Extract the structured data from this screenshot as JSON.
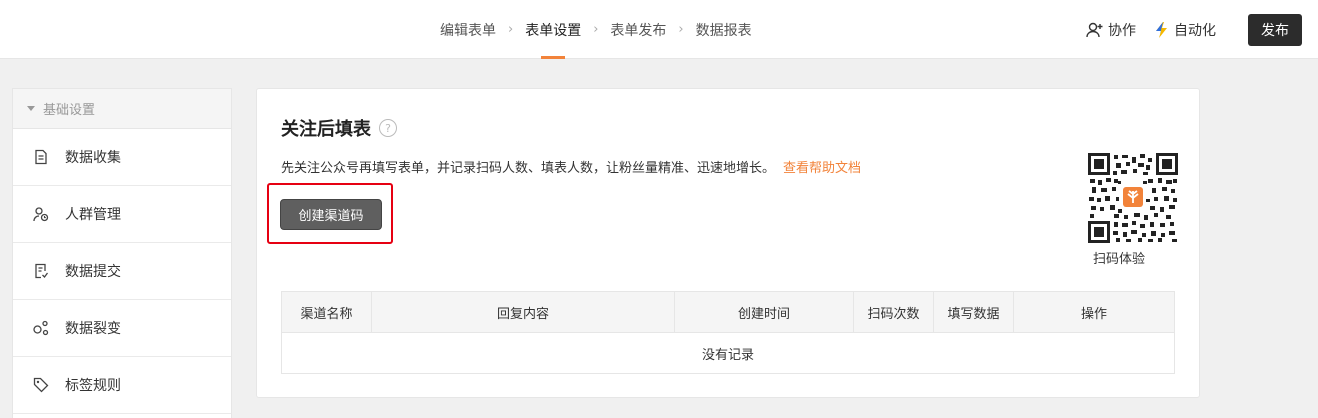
{
  "topnav": {
    "steps": [
      "编辑表单",
      "表单设置",
      "表单发布",
      "数据报表"
    ],
    "active_step": "表单设置",
    "collab_label": "协作",
    "automation_label": "自动化",
    "publish_label": "发布"
  },
  "sidebar": {
    "section_title": "基础设置",
    "items": [
      {
        "label": "数据收集",
        "icon": "document-icon"
      },
      {
        "label": "人群管理",
        "icon": "user-group-icon"
      },
      {
        "label": "数据提交",
        "icon": "submit-doc-icon"
      },
      {
        "label": "数据裂变",
        "icon": "share-nodes-icon"
      },
      {
        "label": "标签规则",
        "icon": "tag-icon"
      }
    ]
  },
  "main": {
    "title": "关注后填表",
    "description": "先关注公众号再填写表单，并记录扫码人数、填表人数，让粉丝量精准、迅速地增长。",
    "help_link": "查看帮助文档",
    "create_button": "创建渠道码",
    "qr_label": "扫码体验",
    "table": {
      "columns": [
        "渠道名称",
        "回复内容",
        "创建时间",
        "扫码次数",
        "填写数据",
        "操作"
      ],
      "empty_text": "没有记录"
    }
  },
  "colors": {
    "accent": "#f2833a",
    "highlight_border": "#e60012",
    "dark_button": "#2c2c2c"
  }
}
